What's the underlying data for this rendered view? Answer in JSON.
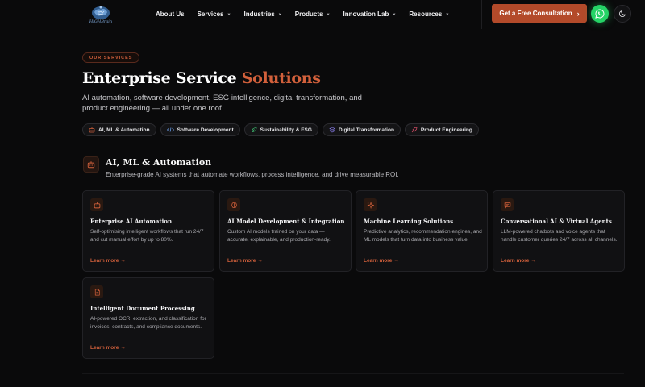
{
  "nav": {
    "logo_text": "HiGHBrain",
    "links": [
      {
        "label": "About Us",
        "has_dropdown": false
      },
      {
        "label": "Services",
        "has_dropdown": true
      },
      {
        "label": "Industries",
        "has_dropdown": true
      },
      {
        "label": "Products",
        "has_dropdown": true
      },
      {
        "label": "Innovation Lab",
        "has_dropdown": true
      },
      {
        "label": "Resources",
        "has_dropdown": true
      }
    ],
    "cta_label": "Get a Free Consultation",
    "cta_icon": "chevron-right-icon",
    "whatsapp_icon": "whatsapp-icon",
    "theme_icon": "moon-icon"
  },
  "hero": {
    "eyebrow": "OUR SERVICES",
    "title_main": "Enterprise Service",
    "title_accent": "Solutions",
    "subtitle": "AI automation, software development, ESG intelligence, digital transformation, and product engineering — all under one roof.",
    "chips": [
      {
        "label": "AI, ML & Automation",
        "icon": "robot-icon"
      },
      {
        "label": "Software Development",
        "icon": "code-icon"
      },
      {
        "label": "Sustainability & ESG",
        "icon": "leaf-icon"
      },
      {
        "label": "Digital Transformation",
        "icon": "layers-icon"
      },
      {
        "label": "Product Engineering",
        "icon": "rocket-icon"
      }
    ]
  },
  "section": {
    "icon": "robot-icon",
    "title": "AI, ML & Automation",
    "subtitle": "Enterprise-grade AI systems that automate workflows, process intelligence, and drive measurable ROI."
  },
  "cards": [
    {
      "icon": "robot-icon",
      "title": "Enterprise AI Automation",
      "description": "Self-optimising intelligent workflows that run 24/7 and cut manual effort by up to 80%.",
      "link": "Learn more →"
    },
    {
      "icon": "brain-icon",
      "title": "AI Model Development & Integration",
      "description": "Custom AI models trained on your data — accurate, explainable, and production-ready.",
      "link": "Learn more →"
    },
    {
      "icon": "sparkles-icon",
      "title": "Machine Learning Solutions",
      "description": "Predictive analytics, recommendation engines, and ML models that turn data into business value.",
      "link": "Learn more →"
    },
    {
      "icon": "chat-icon",
      "title": "Conversational AI & Virtual Agents",
      "description": "LLM-powered chatbots and voice agents that handle customer queries 24/7 across all channels.",
      "link": "Learn more →"
    },
    {
      "icon": "document-icon",
      "title": "Intelligent Document Processing",
      "description": "AI-powered OCR, extraction, and classification for invoices, contracts, and compliance documents.",
      "link": "Learn more →"
    }
  ],
  "colors": {
    "accent": "#d2603b",
    "cta_bg": "#b34a2a",
    "whatsapp": "#25d366",
    "background": "#0a0a0b"
  }
}
